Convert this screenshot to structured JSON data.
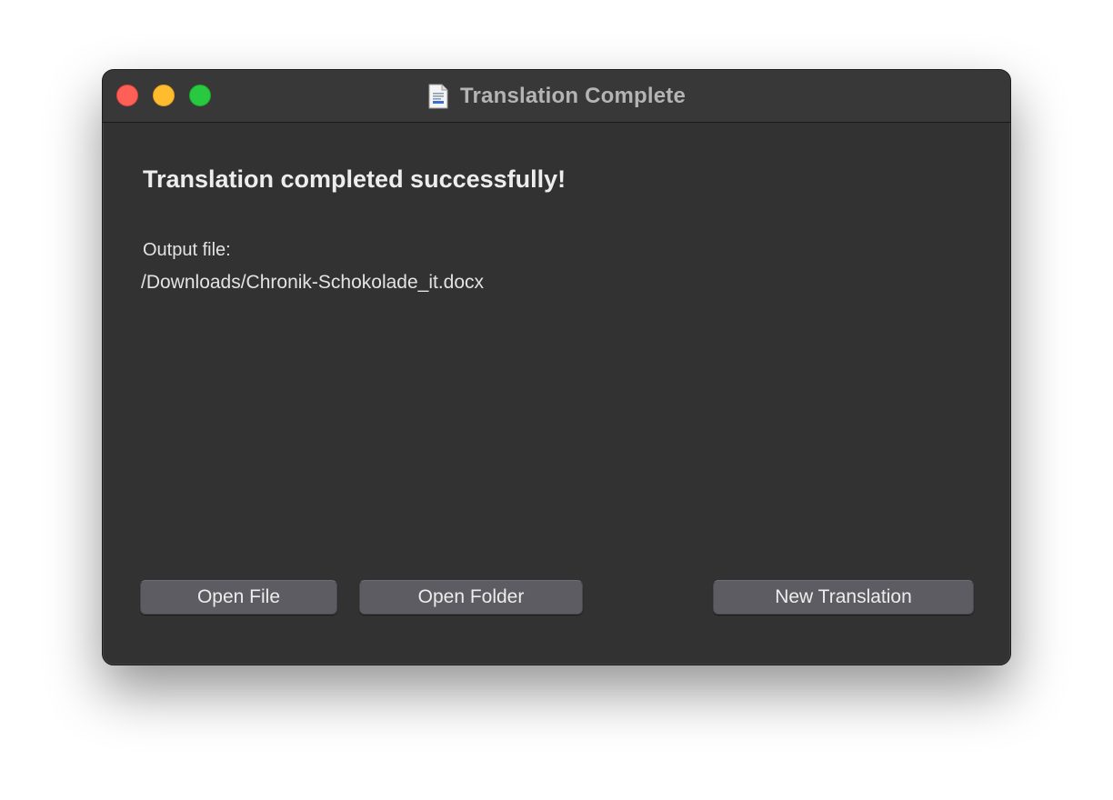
{
  "window": {
    "title": "Translation Complete",
    "title_icon": "document-icon",
    "controls": [
      "close",
      "minimize",
      "zoom"
    ]
  },
  "main": {
    "headline": "Translation completed successfully!",
    "output_label": "Output file:",
    "output_path": "/Downloads/Chronik-Schokolade_it.docx"
  },
  "buttons": {
    "open_file": "Open File",
    "open_folder": "Open Folder",
    "new_translation": "New Translation"
  },
  "colors": {
    "window_bg": "#323232",
    "titlebar_bg": "#383838",
    "button_bg": "#5e5c63",
    "close": "#fe5f57",
    "minimize": "#febc2e",
    "zoom": "#28c840"
  }
}
